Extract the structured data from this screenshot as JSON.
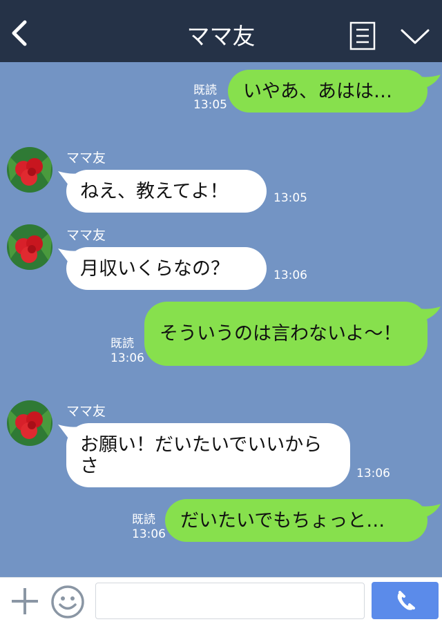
{
  "header": {
    "title": "ママ友",
    "back_icon": "chevron-left-icon",
    "menu_icon": "list-icon",
    "down_icon": "chevron-down-icon",
    "background": "#253247"
  },
  "colors": {
    "chat_background": "#7394c4",
    "sent_bubble": "#87e04d",
    "received_bubble": "#ffffff",
    "call_button": "#5b8bea"
  },
  "messages": [
    {
      "direction": "sent",
      "text": "いやあ、あはは…",
      "read": "既読",
      "time": "13:05"
    },
    {
      "direction": "received",
      "sender": "ママ友",
      "text": "ねえ、教えてよ！",
      "time": "13:05"
    },
    {
      "direction": "received",
      "sender": "ママ友",
      "text": "月収いくらなの？",
      "time": "13:06"
    },
    {
      "direction": "sent",
      "text": "そういうのは言わないよ〜！",
      "read": "既読",
      "time": "13:06"
    },
    {
      "direction": "received",
      "sender": "ママ友",
      "text": "お願い！だいたいでいいからさ",
      "time": "13:06"
    },
    {
      "direction": "sent",
      "text": "だいたいでもちょっと…",
      "read": "既読",
      "time": "13:06"
    }
  ],
  "footer": {
    "plus_icon": "plus-icon",
    "emoji_icon": "smiley-icon",
    "call_icon": "phone-icon",
    "input_value": "",
    "input_placeholder": ""
  }
}
